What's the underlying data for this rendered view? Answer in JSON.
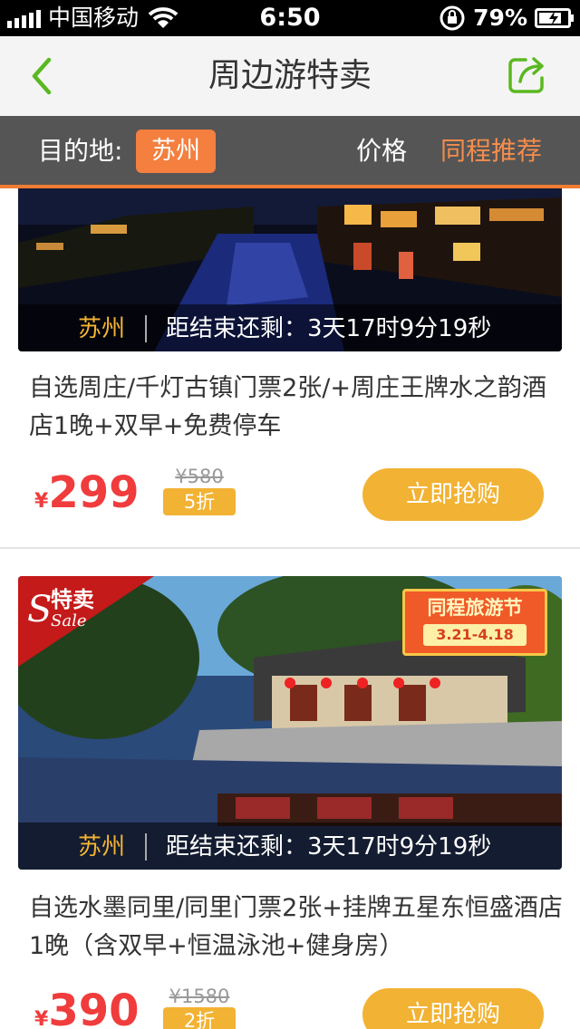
{
  "status_bar": {
    "carrier": "中国移动",
    "time": "6:50",
    "battery_percent": "79%",
    "icons": [
      "signal-icon",
      "wifi-icon",
      "rotation-lock-icon",
      "battery-icon"
    ]
  },
  "nav": {
    "title": "周边游特卖",
    "icons": [
      "back-chevron-icon",
      "share-icon"
    ]
  },
  "filter": {
    "destination_label": "目的地:",
    "city": "苏州",
    "price_label": "价格",
    "recommend_label": "同程推荐"
  },
  "colors": {
    "accent": "#f07c32",
    "brand_green": "#5ab820",
    "button": "#f2b233",
    "price": "#f03c3c"
  },
  "deals": [
    {
      "city": "苏州",
      "countdown": "距结束还剩：3天17时9分19秒",
      "title": "自选周庄/千灯古镇门票2张/+周庄王牌水之韵酒店1晚+双早+免费停车",
      "currency": "¥",
      "price": "299",
      "original_price": "¥580",
      "discount": "5折",
      "buy_label": "立即抢购"
    },
    {
      "city": "苏州",
      "countdown": "距结束还剩：3天17时9分19秒",
      "title": "自选水墨同里/同里门票2张+挂牌五星东恒盛酒店1晚（含双早+恒温泳池+健身房）",
      "currency": "¥",
      "price": "390",
      "original_price": "¥1580",
      "discount": "2折",
      "buy_label": "立即抢购",
      "sale_badge": {
        "script": "Sale",
        "text": "特卖"
      },
      "festival_badge": {
        "title": "同程旅游节",
        "date": "3.21-4.18"
      }
    }
  ]
}
